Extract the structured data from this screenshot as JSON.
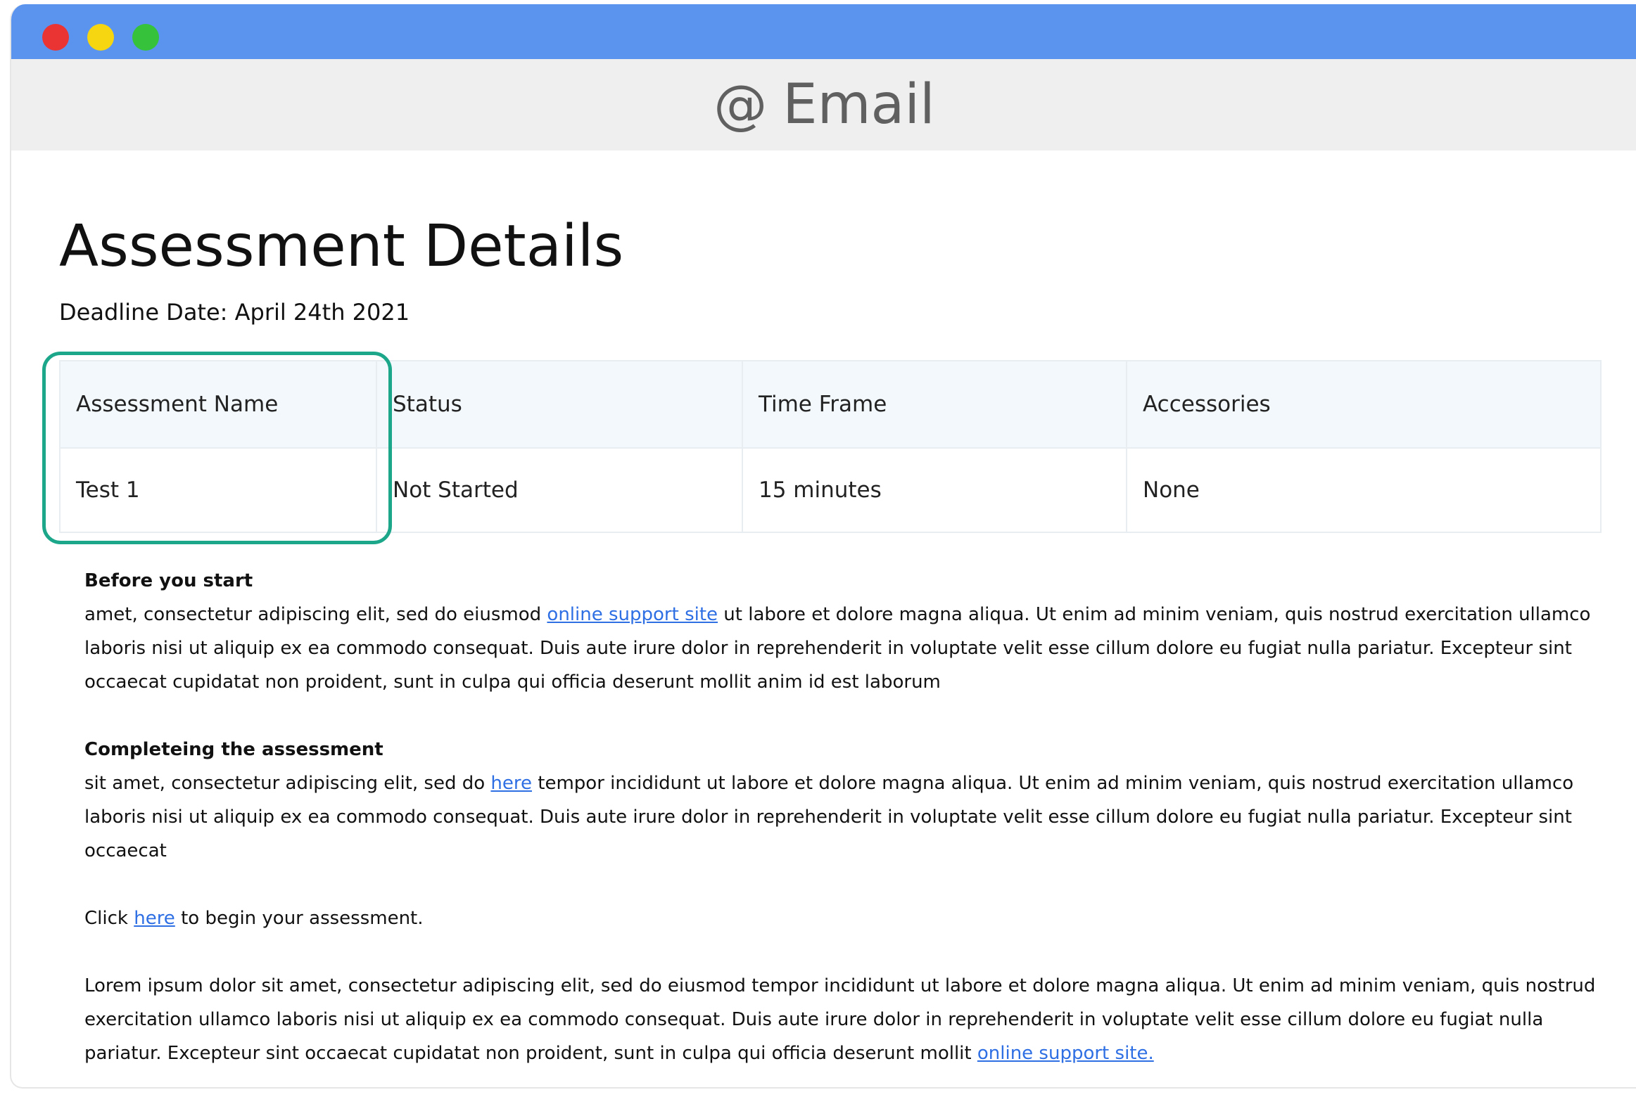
{
  "window": {
    "controls": [
      "close",
      "minimize",
      "zoom"
    ],
    "colors": {
      "titlebar": "#5a94ef",
      "close": "#ea3434",
      "minimize": "#f6d511",
      "zoom": "#36c23a",
      "highlight": "#1da78a",
      "link": "#2f6fe4"
    }
  },
  "app": {
    "at_symbol": "@",
    "title": "Email"
  },
  "page": {
    "title": "Assessment Details",
    "deadline": "Deadline Date: April 24th 2021"
  },
  "table": {
    "headers": [
      "Assessment Name",
      "Status",
      "Time Frame",
      "Accessories"
    ],
    "rows": [
      [
        "Test 1",
        "Not Started",
        "15 minutes",
        "None"
      ]
    ]
  },
  "sections": {
    "before": {
      "heading": "Before you start",
      "text_1": "amet, consectetur adipiscing elit, sed do eiusmod ",
      "link": "online support site",
      "text_2": " ut labore et dolore magna aliqua. Ut enim ad minim veniam, quis nostrud exercitation ullamco laboris nisi ut aliquip ex ea commodo consequat. Duis aute irure dolor in reprehenderit in voluptate velit esse cillum dolore eu fugiat nulla pariatur. Excepteur sint occaecat cupidatat non proident, sunt in culpa qui officia deserunt mollit anim id est laborum"
    },
    "completing": {
      "heading": "Completeing the assessment",
      "text_1": "sit amet, consectetur adipiscing elit, sed do ",
      "link": "here",
      "text_2": " tempor incididunt ut labore et dolore magna aliqua. Ut enim ad minim veniam, quis nostrud exercitation ullamco laboris nisi ut aliquip ex ea commodo consequat. Duis aute irure dolor in reprehenderit in voluptate velit esse cillum dolore eu fugiat nulla pariatur. Excepteur sint occaecat"
    },
    "click": {
      "text_1": "Click ",
      "link": "here",
      "text_2": " to begin your assessment."
    },
    "lorem": {
      "text_1": "Lorem ipsum dolor sit amet, consectetur adipiscing elit, sed do eiusmod tempor incididunt ut labore et dolore magna aliqua. Ut enim ad minim veniam, quis nostrud exercitation ullamco laboris nisi ut aliquip ex ea commodo consequat. Duis aute irure dolor in reprehenderit in voluptate velit esse cillum dolore eu fugiat nulla pariatur. Excepteur sint occaecat cupidatat non proident, sunt in culpa qui officia deserunt mollit ",
      "link": "online support site."
    }
  }
}
